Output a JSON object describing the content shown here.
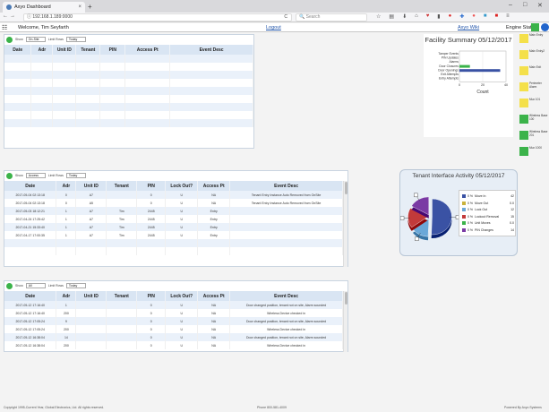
{
  "browser": {
    "tab_title": "Axyo Dashboard",
    "tab_close": "×",
    "new_tab": "+",
    "url": "ⓘ 192.168.1.189:0000",
    "search_placeholder": "Search",
    "win_min": "–",
    "win_max": "□",
    "win_close": "✕",
    "back": "←",
    "forward": "→",
    "reload": "C"
  },
  "app": {
    "welcome": "Welcome, Tim Seyfarth",
    "logout": "Logout",
    "wiki": "Axyo Wiki",
    "engine_status": "Engine Status"
  },
  "panel1": {
    "filter1": "On-Site",
    "filter2_label": "Limit Rows",
    "filter2": "Today",
    "columns": [
      "Date",
      "Adr",
      "Unit ID",
      "Tenant",
      "PIN",
      "Access Pt",
      "Event Desc"
    ],
    "empty_rows": 9
  },
  "panel2": {
    "filter1": "Access",
    "filter2_label": "Limit Rows",
    "filter2": "Today",
    "columns": [
      "Date",
      "Adr",
      "Unit ID",
      "Tenant",
      "PIN",
      "Lock Out?",
      "Access Pt",
      "Event Desc"
    ],
    "rows": [
      [
        "2017-05-04 02:13:18",
        "0",
        "A7",
        "",
        "0",
        "U",
        "NA",
        "Tenant Entry Instance Auto Removed from OnSite"
      ],
      [
        "2017-05-04 02:13:18",
        "0",
        "A5",
        "",
        "0",
        "U",
        "NA",
        "Tenant Entry Instance Auto Removed from OnSite"
      ],
      [
        "2017-05-03 18:12:21",
        "1",
        "A7",
        "Tim",
        "2445",
        "U",
        "Entry",
        ""
      ],
      [
        "2017-04-24 17:25:42",
        "1",
        "A7",
        "Tim",
        "2445",
        "U",
        "Entry",
        ""
      ],
      [
        "2017-04-21 15:33:40",
        "1",
        "A7",
        "Tim",
        "2445",
        "U",
        "Entry",
        ""
      ],
      [
        "2017-04-17 17:00:35",
        "1",
        "A7",
        "Tim",
        "2445",
        "U",
        "Entry",
        ""
      ],
      [
        "",
        "",
        "",
        "",
        "",
        "",
        "",
        ""
      ],
      [
        "",
        "",
        "",
        "",
        "",
        "",
        "",
        ""
      ]
    ]
  },
  "panel3": {
    "filter1": "All",
    "filter2_label": "Limit Rows",
    "filter2": "Today",
    "columns": [
      "Date",
      "Adr",
      "Unit ID",
      "Tenant",
      "PIN",
      "Lock Out?",
      "Access Pt",
      "Event Desc"
    ],
    "rows": [
      [
        "2017-05-12 17:16:40",
        "1",
        "",
        "",
        "0",
        "U",
        "NA",
        "Door changed position, tenant not on site, Alarm sounded"
      ],
      [
        "2017-05-12 17:16:40",
        "200",
        "",
        "",
        "0",
        "U",
        "NA",
        "Wireless Device checked in"
      ],
      [
        "2017-05-12 17:05:24",
        "9",
        "",
        "",
        "0",
        "U",
        "NA",
        "Door changed position, tenant not on site, Alarm sounded"
      ],
      [
        "2017-05-12 17:05:24",
        "200",
        "",
        "",
        "0",
        "U",
        "NA",
        "Wireless Device checked in"
      ],
      [
        "2017-05-12 16:38:04",
        "14",
        "",
        "",
        "0",
        "U",
        "NA",
        "Door changed position, tenant not on site, Alarm sounded"
      ],
      [
        "2017-05-12 16:38:04",
        "200",
        "",
        "",
        "0",
        "U",
        "NA",
        "Wireless Device checked in"
      ]
    ]
  },
  "chart_data": [
    {
      "type": "bar",
      "orientation": "horizontal",
      "title": "Facility Summary 05/12/2017",
      "categories": [
        "Tamper Events",
        "PIN Updates",
        "Alarms",
        "Door Closures",
        "Door Openings",
        "Exit Attempts",
        "Entry Attempts"
      ],
      "values": [
        0,
        0,
        0,
        9,
        35,
        0,
        0
      ],
      "colors": [
        "#3bb34a",
        "#3bb34a",
        "#3bb34a",
        "#3bb34a",
        "#3a52a4",
        "#3bb34a",
        "#3bb34a"
      ],
      "xlabel": "Count",
      "xticks": [
        0,
        20,
        40
      ],
      "xlim": [
        0,
        40
      ]
    },
    {
      "type": "pie",
      "title": "Tenant Interface Activity 05/12/2017",
      "labels": [
        "Move In",
        "Move Out",
        "Lock Out",
        "Lockout Removal",
        "Unit Moves",
        "PIN Changes"
      ],
      "legend_prefix": [
        "0 %",
        "0 %",
        "0 %",
        "0 %",
        "0 %",
        "0 %"
      ],
      "values": [
        42,
        0,
        12,
        15,
        0,
        14
      ],
      "legend_values": [
        "42",
        "0.0",
        "12",
        "15",
        "0.0",
        "14"
      ],
      "colors": [
        "#3a52a4",
        "#c9b23a",
        "#6aa8d8",
        "#c23a3a",
        "#3bb34a",
        "#7a3aa4"
      ]
    }
  ],
  "sidebar": [
    {
      "label": "Main Entry",
      "color": "#f4e04a"
    },
    {
      "label": "Main Entry2",
      "color": "#f4e04a"
    },
    {
      "label": "Main Exit",
      "color": "#f4e04a"
    },
    {
      "label": "Perimeter Alarm",
      "color": "#f4e04a"
    },
    {
      "label": "Mux 101",
      "color": "#f4e04a"
    },
    {
      "label": "Wireless Base 100",
      "color": "#3bb34a"
    },
    {
      "label": "Wireless Base 201",
      "color": "#3bb34a"
    },
    {
      "label": "Mux 1000",
      "color": "#3bb34a"
    }
  ],
  "footer": {
    "copyright": "Copyright 1995-Current Year, Global Electronics, Ltd. All rights reserved.",
    "phone": "Phone 800-581-4009",
    "powered": "Powered By Axyo Systems"
  }
}
